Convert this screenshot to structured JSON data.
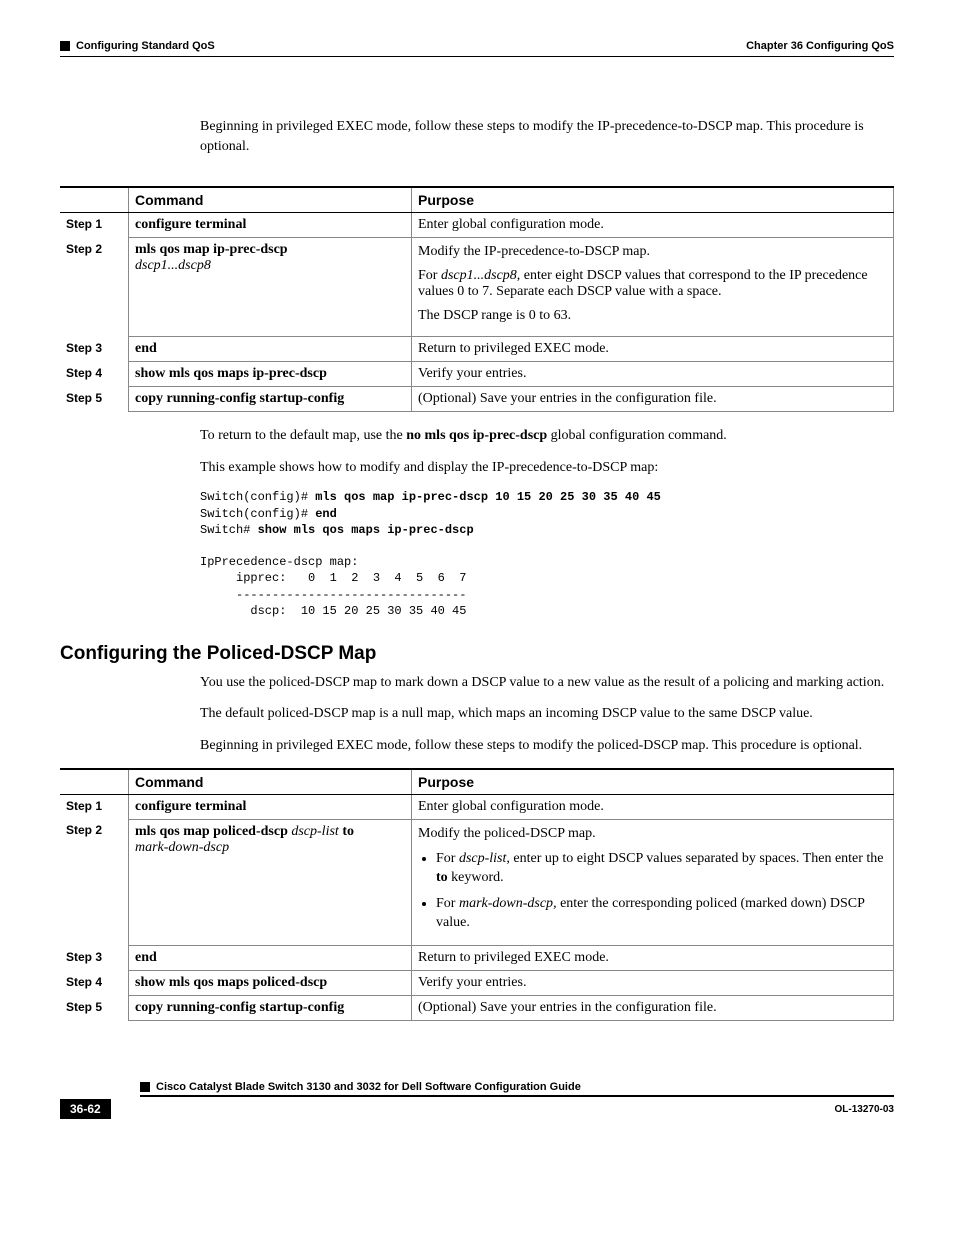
{
  "header": {
    "chapter": "Chapter 36    Configuring QoS",
    "section": "Configuring Standard QoS"
  },
  "intro1": "Beginning in privileged EXEC mode, follow these steps to modify the IP-precedence-to-DSCP map. This procedure is optional.",
  "table1": {
    "h_command": "Command",
    "h_purpose": "Purpose",
    "r1": {
      "step": "Step 1",
      "cmd": "configure terminal",
      "purpose": "Enter global configuration mode."
    },
    "r2": {
      "step": "Step 2",
      "cmd_bold": "mls qos map ip-prec-dscp",
      "cmd_ital": "dscp1...dscp8",
      "p1": "Modify the IP-precedence-to-DSCP map.",
      "p2a": "For ",
      "p2i": "dscp1...dscp8",
      "p2b": ", enter eight DSCP values that correspond to the IP precedence values 0 to 7. Separate each DSCP value with a space.",
      "p3": "The DSCP range is 0 to 63."
    },
    "r3": {
      "step": "Step 3",
      "cmd": "end",
      "purpose": "Return to privileged EXEC mode."
    },
    "r4": {
      "step": "Step 4",
      "cmd": "show mls qos maps ip-prec-dscp",
      "purpose": "Verify your entries."
    },
    "r5": {
      "step": "Step 5",
      "cmd": "copy running-config startup-config",
      "purpose": "(Optional) Save your entries in the configuration file."
    }
  },
  "post1": {
    "p1a": "To return to the default map, use the ",
    "p1b": "no mls qos ip-prec-dscp",
    "p1c": " global configuration command.",
    "p2": "This example shows how to modify and display the IP-precedence-to-DSCP map:"
  },
  "code1": "Switch(config)# mls qos map ip-prec-dscp 10 15 20 25 30 35 40 45\nSwitch(config)# end\nSwitch# show mls qos maps ip-prec-dscp\n\nIpPrecedence-dscp map:\n     ipprec:   0  1  2  3  4  5  6  7\n     --------------------------------\n       dscp:  10 15 20 25 30 35 40 45",
  "code1_lines": {
    "l1a": "Switch(config)# ",
    "l1b": "mls qos map ip-prec-dscp 10 15 20 25 30 35 40 45",
    "l2a": "Switch(config)# ",
    "l2b": "end",
    "l3a": "Switch# ",
    "l3b": "show mls qos maps ip-prec-dscp",
    "l4": "",
    "l5": "IpPrecedence-dscp map:",
    "l6": "     ipprec:   0  1  2  3  4  5  6  7",
    "l7": "     --------------------------------",
    "l8": "       dscp:  10 15 20 25 30 35 40 45"
  },
  "section2_title": "Configuring the Policed-DSCP Map",
  "intro2": {
    "p1": "You use the policed-DSCP map to mark down a DSCP value to a new value as the result of a policing and marking action.",
    "p2": "The default policed-DSCP map is a null map, which maps an incoming DSCP value to the same DSCP value.",
    "p3": "Beginning in privileged EXEC mode, follow these steps to modify the policed-DSCP map. This procedure is optional."
  },
  "table2": {
    "h_command": "Command",
    "h_purpose": "Purpose",
    "r1": {
      "step": "Step 1",
      "cmd": "configure terminal",
      "purpose": "Enter global configuration mode."
    },
    "r2": {
      "step": "Step 2",
      "cmd_b1": "mls qos map policed-dscp ",
      "cmd_i1": "dscp-list ",
      "cmd_b2": "to",
      "cmd_i2": "mark-down-dscp",
      "p1": "Modify the policed-DSCP map.",
      "b1a": "For ",
      "b1i": "dscp-list",
      "b1b": ", enter up to eight DSCP values separated by spaces. Then enter the ",
      "b1c": "to",
      "b1d": " keyword.",
      "b2a": "For ",
      "b2i": "mark-down-dscp",
      "b2b": ", enter the corresponding policed (marked down) DSCP value."
    },
    "r3": {
      "step": "Step 3",
      "cmd": "end",
      "purpose": "Return to privileged EXEC mode."
    },
    "r4": {
      "step": "Step 4",
      "cmd": "show mls qos maps policed-dscp",
      "purpose": "Verify your entries."
    },
    "r5": {
      "step": "Step 5",
      "cmd": "copy running-config startup-config",
      "purpose": "(Optional) Save your entries in the configuration file."
    }
  },
  "footer": {
    "guide": "Cisco Catalyst Blade Switch 3130 and 3032 for Dell Software Configuration Guide",
    "page": "36-62",
    "docid": "OL-13270-03"
  }
}
